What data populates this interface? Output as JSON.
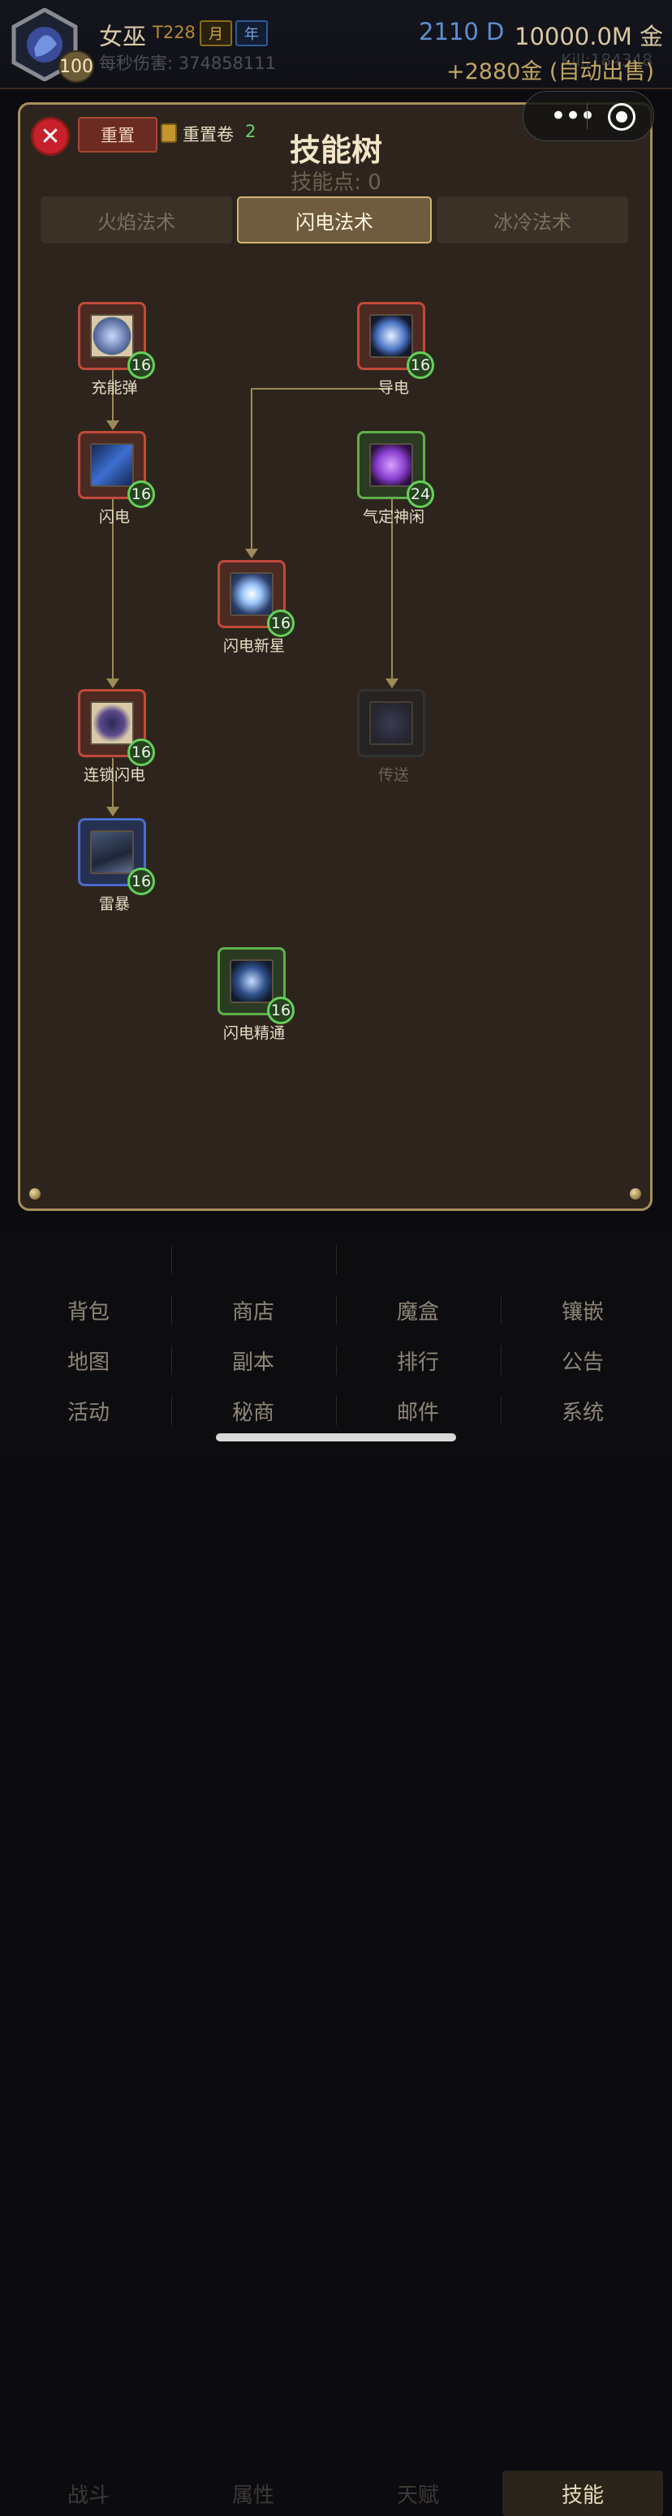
{
  "header": {
    "class_name": "女巫",
    "tier": "T228",
    "badge_month": "月",
    "badge_year": "年",
    "level": "100",
    "dps_label": "每秒伤害: 374858111",
    "d_value": "2110 D",
    "gold": "10000.0M 金",
    "gold_income": "+2880金 (自动出售)",
    "kill_text": "Kill:184348"
  },
  "capsule": {
    "more_icon": "more-dots-icon",
    "target_icon": "target-icon"
  },
  "panel": {
    "title": "技能树",
    "points_label": "技能点: 0",
    "reset_label": "重置",
    "scroll_label": "重置卷",
    "scroll_count": "2",
    "tabs": [
      {
        "label": "火焰法术",
        "active": false
      },
      {
        "label": "闪电法术",
        "active": true
      },
      {
        "label": "冰冷法术",
        "active": false
      }
    ]
  },
  "skills": [
    {
      "id": "charged-bolt",
      "name": "充能弹",
      "level": "16",
      "state": "red",
      "icon_color": "#8fa8d8"
    },
    {
      "id": "static-field",
      "name": "导电",
      "level": "16",
      "state": "red",
      "icon_color": "#6b8ec8"
    },
    {
      "id": "lightning",
      "name": "闪电",
      "level": "16",
      "state": "red",
      "icon_color": "#3d6fd0"
    },
    {
      "id": "composure",
      "name": "气定神闲",
      "level": "24",
      "state": "green",
      "icon_color": "#8a3fcf"
    },
    {
      "id": "nova",
      "name": "闪电新星",
      "level": "16",
      "state": "red",
      "icon_color": "#9cc8ff"
    },
    {
      "id": "chain-lightning",
      "name": "连锁闪电",
      "level": "16",
      "state": "red",
      "icon_color": "#5c4a8c"
    },
    {
      "id": "teleport",
      "name": "传送",
      "level": "",
      "state": "locked",
      "icon_color": "#3a3a5a"
    },
    {
      "id": "thunderstorm",
      "name": "雷暴",
      "level": "16",
      "state": "blue",
      "icon_color": "#2e3a58"
    },
    {
      "id": "lightning-mastery",
      "name": "闪电精通",
      "level": "16",
      "state": "green",
      "icon_color": "#2f4f8a"
    }
  ],
  "nav": {
    "row1": [
      "战斗",
      "属性",
      "天赋",
      "技能"
    ],
    "row2": [
      "背包",
      "商店",
      "魔盒",
      "镶嵌"
    ],
    "row3": [
      "地图",
      "副本",
      "排行",
      "公告"
    ],
    "row4": [
      "活动",
      "秘商",
      "邮件",
      "系统"
    ]
  }
}
